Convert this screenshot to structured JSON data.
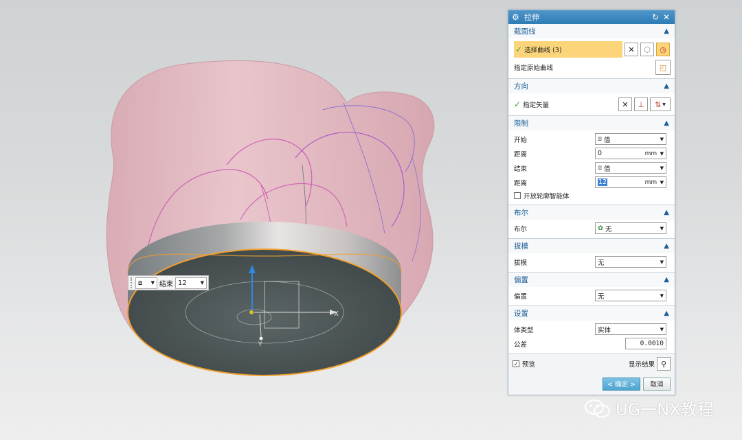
{
  "canvas": {
    "axis_x": "X",
    "axis_y": "Y",
    "mini_toolbar": {
      "label": "结束",
      "value": "12",
      "icon": "cube-icon"
    }
  },
  "dialog": {
    "title": "拉伸",
    "title_icon": "gear-icon",
    "sections": {
      "section_curve": {
        "header": "截面线",
        "select_curve": "选择曲线 (3)",
        "specify_origin": "指定原始曲线"
      },
      "direction": {
        "header": "方向",
        "specify_vector": "指定矢量"
      },
      "limits": {
        "header": "限制",
        "start_label": "开始",
        "start_value": "值",
        "start_dist_label": "距离",
        "start_dist": "0",
        "start_unit": "mm",
        "end_label": "结束",
        "end_value": "值",
        "end_dist_label": "距离",
        "end_dist": "12",
        "end_unit": "mm",
        "open_profile": "开放轮廓智能体"
      },
      "boolean": {
        "header": "布尔",
        "label": "布尔",
        "value": "无"
      },
      "draft": {
        "header": "拔模",
        "label": "拔模",
        "value": "无"
      },
      "offset": {
        "header": "偏置",
        "label": "偏置",
        "value": "无"
      },
      "settings": {
        "header": "设置",
        "body_type_label": "体类型",
        "body_type_value": "实体",
        "tolerance_label": "公差",
        "tolerance_value": "0.0010"
      }
    },
    "footer": {
      "preview": "预览",
      "show_result": "显示结果",
      "ok": "< 确定 >",
      "cancel": "取消"
    }
  },
  "watermark": "UG一NX教程",
  "colors": {
    "title_bar": "#2f7cb6",
    "section_header_text": "#1f5f97",
    "selection_highlight": "#fcd57a",
    "model_pink": "#e8b4bd",
    "disk_dark": "#4a5354",
    "edge_orange": "#f0a030"
  }
}
